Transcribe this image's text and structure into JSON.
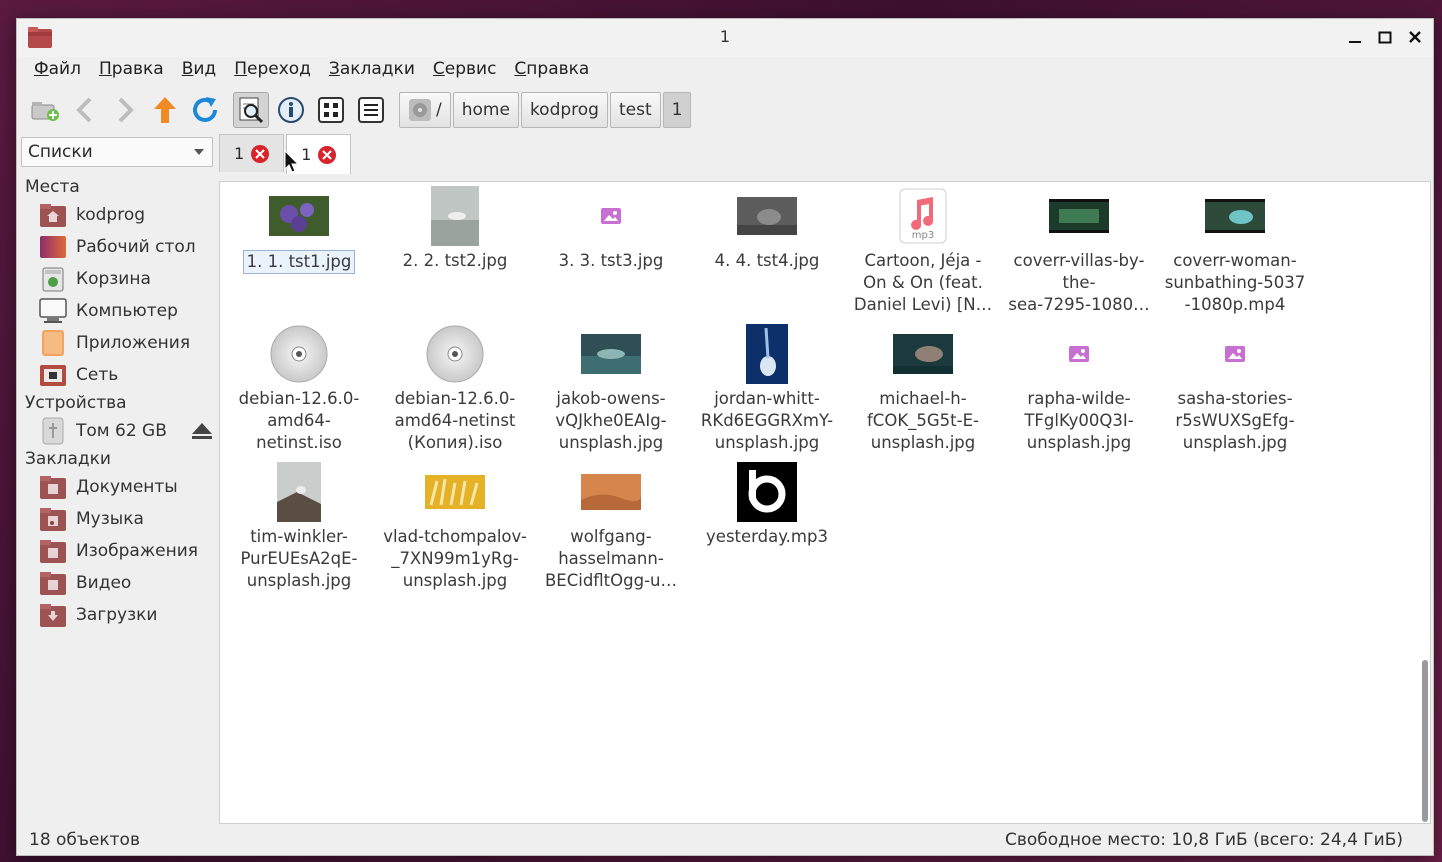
{
  "window": {
    "title": "1"
  },
  "menu": [
    "Файл",
    "Правка",
    "Вид",
    "Переход",
    "Закладки",
    "Сервис",
    "Справка"
  ],
  "breadcrumb": [
    "/",
    "home",
    "kodprog",
    "test",
    "1"
  ],
  "sidebar": {
    "select_value": "Списки",
    "sections": [
      {
        "header": "Места",
        "items": [
          "kodprog",
          "Рабочий стол",
          "Корзина",
          "Компьютер",
          "Приложения",
          "Сеть"
        ]
      },
      {
        "header": "Устройства",
        "items": [
          "Том 62 GB"
        ]
      },
      {
        "header": "Закладки",
        "items": [
          "Документы",
          "Музыка",
          "Изображения",
          "Видео",
          "Загрузки"
        ]
      }
    ]
  },
  "tabs": [
    {
      "label": "1"
    },
    {
      "label": "1"
    }
  ],
  "files": [
    [
      "1. 1. tst1.jpg"
    ],
    [
      "2. 2. tst2.jpg"
    ],
    [
      "3. 3. tst3.jpg"
    ],
    [
      "4. 4. tst4.jpg"
    ],
    [
      "Cartoon, Jéja -",
      "On & On (feat.",
      "Daniel Levi) [N…"
    ],
    [
      "coverr-villas-by-",
      "the-",
      "sea-7295-1080…"
    ],
    [
      "coverr-woman-",
      "sunbathing-5037",
      "-1080p.mp4"
    ],
    [
      "debian-12.6.0-",
      "amd64-",
      "netinst.iso"
    ],
    [
      "debian-12.6.0-",
      "amd64-netinst",
      "(Копия).iso"
    ],
    [
      "jakob-owens-",
      "vQJkhe0EAIg-",
      "unsplash.jpg"
    ],
    [
      "jordan-whitt-",
      "RKd6EGGRXmY-",
      "unsplash.jpg"
    ],
    [
      "michael-h-",
      "fCOK_5G5t-E-",
      "unsplash.jpg"
    ],
    [
      "rapha-wilde-",
      "TFglKy00Q3I-",
      "unsplash.jpg"
    ],
    [
      "sasha-stories-",
      "r5sWUXSgEfg-",
      "unsplash.jpg"
    ],
    [
      "tim-winkler-",
      "PurEUEsA2qE-",
      "unsplash.jpg"
    ],
    [
      "vlad-tchompalov-",
      "_7XN99m1yRg-",
      "unsplash.jpg"
    ],
    [
      "wolfgang-",
      "hasselmann-",
      "BECidfltOgg-u…"
    ],
    [
      "yesterday.mp3"
    ]
  ],
  "mp3_badge": "mp3",
  "status": {
    "count": "18 объектов",
    "free": "Свободное место: 10,8 ГиБ (всего: 24,4 ГиБ)"
  }
}
